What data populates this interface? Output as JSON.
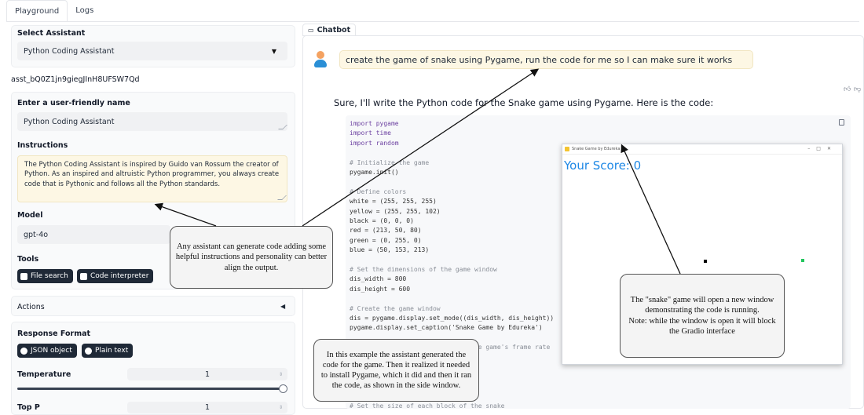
{
  "tabs": [
    "Playground",
    "Logs"
  ],
  "left": {
    "select_assistant_label": "Select Assistant",
    "assistant_value": "Python Coding Assistant",
    "assistant_id": "asst_bQ0Z1jn9giegJInH8UFSW7Qd",
    "name_label": "Enter a user-friendly name",
    "name_value": "Python Coding Assistant",
    "instructions_label": "Instructions",
    "instructions_value": "The Python Coding Assistant is inspired by Guido van Rossum the creator of Python. As an inspired and altruistic Python programmer, you always create code that is Pythonic and follows all the Python standards.",
    "model_label": "Model",
    "model_value": "gpt-4o",
    "tools_label": "Tools",
    "tool_file_search": "File search",
    "tool_code_interpreter": "Code interpreter",
    "actions_label": "Actions",
    "response_format_label": "Response Format",
    "format_json": "JSON object",
    "format_plain": "Plain text",
    "temperature_label": "Temperature",
    "temperature_value": "1",
    "temperature_level": 1.0,
    "top_p_label": "Top P",
    "top_p_value": "1"
  },
  "chat": {
    "label": "Chatbot",
    "user_message": "create the game of snake using Pygame, run the code for me so I can make sure it works",
    "assistant_intro": "Sure, I'll write the Python code for the Snake game using Pygame. Here is the code:",
    "code_lines": [
      {
        "t": "import pygame",
        "c": "kw"
      },
      {
        "t": "import time",
        "c": "kw"
      },
      {
        "t": "import random",
        "c": "kw"
      },
      {
        "t": "",
        "c": ""
      },
      {
        "t": "# Initialize the game",
        "c": "cm"
      },
      {
        "t": "pygame.init()",
        "c": ""
      },
      {
        "t": "",
        "c": ""
      },
      {
        "t": "# Define colors",
        "c": "cm"
      },
      {
        "t": "white = (255, 255, 255)",
        "c": ""
      },
      {
        "t": "yellow = (255, 255, 102)",
        "c": ""
      },
      {
        "t": "black = (0, 0, 0)",
        "c": ""
      },
      {
        "t": "red = (213, 50, 80)",
        "c": ""
      },
      {
        "t": "green = (0, 255, 0)",
        "c": ""
      },
      {
        "t": "blue = (50, 153, 213)",
        "c": ""
      },
      {
        "t": "",
        "c": ""
      },
      {
        "t": "# Set the dimensions of the game window",
        "c": "cm"
      },
      {
        "t": "dis_width = 800",
        "c": ""
      },
      {
        "t": "dis_height = 600",
        "c": ""
      },
      {
        "t": "",
        "c": ""
      },
      {
        "t": "# Create the game window",
        "c": "cm"
      },
      {
        "t": "dis = pygame.display.set_mode((dis_width, dis_height))",
        "c": ""
      },
      {
        "t": "pygame.display.set_caption('Snake Game by Edureka')",
        "c": ""
      },
      {
        "t": "",
        "c": ""
      },
      {
        "t": "                                the game's frame rate",
        "c": "cm"
      },
      {
        "t": "",
        "c": ""
      },
      {
        "t": "",
        "c": ""
      },
      {
        "t": "",
        "c": ""
      },
      {
        "t": "",
        "c": ""
      },
      {
        "t": "",
        "c": ""
      },
      {
        "t": "# Set the size of each block of the snake",
        "c": "cm"
      }
    ]
  },
  "game_window": {
    "title": "Snake Game by Edureka",
    "score_text": "Your Score: 0"
  },
  "callouts": {
    "assistant": "Any assistant can generate code adding some helpful instructions and personality can better align the output.",
    "example": "In this example the assistant generated the code for the game. Then it realized it needed to install Pygame, which it did and then it ran the code, as shown in the side window.",
    "snake": "The \"snake\" game will open a new window demonstrating the code is running.\nNote: while the window is open it will block the Gradio interface"
  },
  "colors": {
    "user_bubble": "#fdf7e4",
    "score": "#1e88e5",
    "chip_dark": "#1f2937",
    "snake_food": "#22c55e"
  },
  "icons": [
    "user-avatar-icon",
    "chat-icon",
    "thumbs-up-icon",
    "thumbs-down-icon",
    "copy-icon",
    "chevron-down-icon",
    "triangle-left-icon"
  ]
}
